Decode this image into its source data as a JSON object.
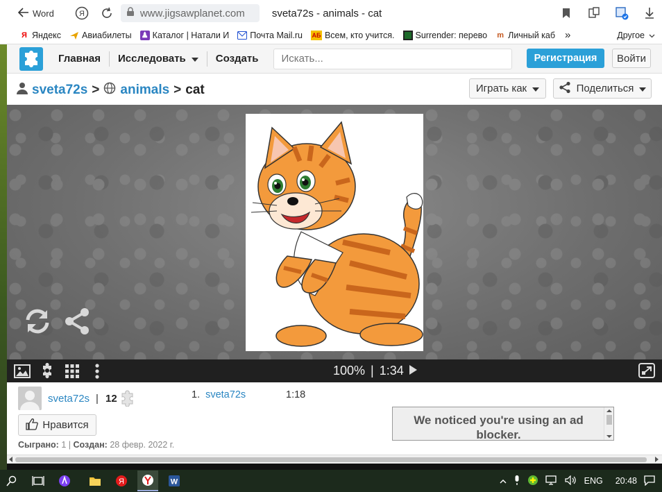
{
  "browser": {
    "back_label": "Word",
    "url": "www.jigsawplanet.com",
    "tab_title": "sveta72s - animals - cat",
    "bookmarks": [
      {
        "icon": "yandex-icon",
        "label": "Яндекс"
      },
      {
        "icon": "plane-icon",
        "label": "Авиабилеты"
      },
      {
        "icon": "catalog-icon",
        "label": "Каталог | Натали И"
      },
      {
        "icon": "mail-icon",
        "label": "Почта Mail.ru"
      },
      {
        "icon": "ab-icon",
        "label": "Всем, кто учится."
      },
      {
        "icon": "surrender-icon",
        "label": "Surrender: перево"
      },
      {
        "icon": "cabinet-icon",
        "label": "Личный каб"
      }
    ],
    "more_label": "»",
    "other_label": "Другое"
  },
  "site": {
    "nav": {
      "home": "Главная",
      "explore": "Исследовать",
      "create": "Создать",
      "search_placeholder": "Искать...",
      "register": "Регистрация",
      "login": "Войти"
    },
    "breadcrumb": {
      "user": "sveta72s",
      "sep1": ">",
      "category": "animals",
      "sep2": ">",
      "current": "cat"
    },
    "play_as": "Играть как",
    "share": "Поделиться",
    "player": {
      "zoom": "100%",
      "divider": "|",
      "time": "1:34"
    },
    "info": {
      "author": "sveta72s",
      "pipe": "|",
      "pieces": "12",
      "leaderboard": [
        {
          "rank": "1.",
          "name": "sveta72s",
          "time": "1:18"
        }
      ],
      "like": "Нравится",
      "played_label": "Сыграно:",
      "played_value": "1",
      "meta_sep": "|",
      "created_label": "Создан:",
      "created_value": "28 февр. 2022 г."
    },
    "ad_notice": "We noticed you're using an ad blocker."
  },
  "taskbar": {
    "language": "ENG",
    "clock": "20:48"
  },
  "colors": {
    "accent": "#2ba0d8",
    "link": "#2a86c2",
    "cat_orange": "#f39a3c",
    "cat_stripe": "#c9661c"
  }
}
